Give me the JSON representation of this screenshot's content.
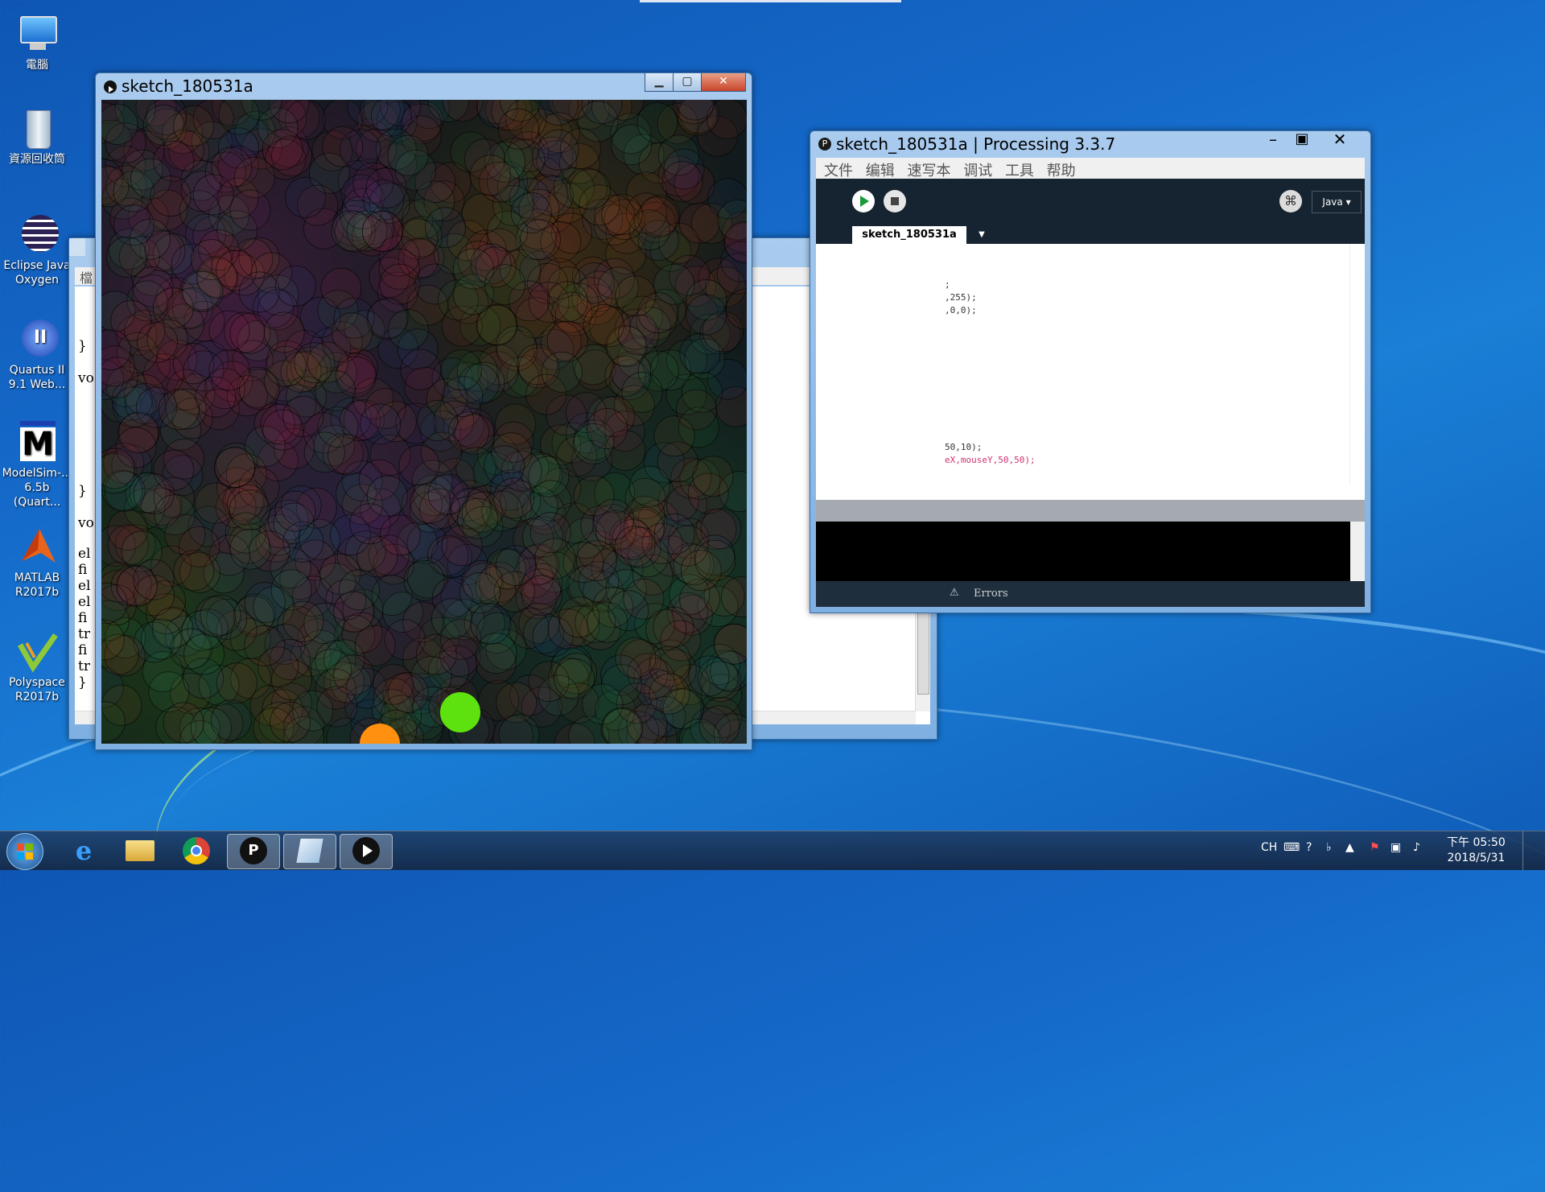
{
  "desktop": {
    "icons": [
      {
        "label": "電腦"
      },
      {
        "label": "資源回收筒"
      },
      {
        "label": "Eclipse Java Oxygen"
      },
      {
        "label": "Quartus II 9.1 Web..."
      },
      {
        "label": "ModelSim-... 6.5b (Quart..."
      },
      {
        "label": "MATLAB R2017b"
      },
      {
        "label": "Polyspace R2017b"
      }
    ]
  },
  "sketch_window": {
    "title": "sketch_180531a",
    "colors": {
      "green_ball": "#5ee20f",
      "orange_ball": "#ff9010"
    }
  },
  "back_window": {
    "code_fragments": [
      "}",
      "vo",
      "}",
      "vo",
      "el",
      "fi",
      "el",
      "el",
      "fi",
      "tr",
      "fi",
      "tr",
      "}"
    ],
    "menu_fragment": "檔"
  },
  "ide_window": {
    "title": "sketch_180531a | Processing 3.3.7",
    "menu": [
      "文件",
      "编辑",
      "速写本",
      "调试",
      "工具",
      "帮助"
    ],
    "mode": "Java ▾",
    "tab": "sketch_180531a",
    "code_lines": [
      ";",
      ",255);",
      ",0,0);",
      "50,10);",
      "eX,mouseY,50,50);"
    ],
    "errors_label": "Errors"
  },
  "taskbar": {
    "tray_lang": "CH",
    "time": "下午 05:50",
    "date": "2018/5/31"
  }
}
